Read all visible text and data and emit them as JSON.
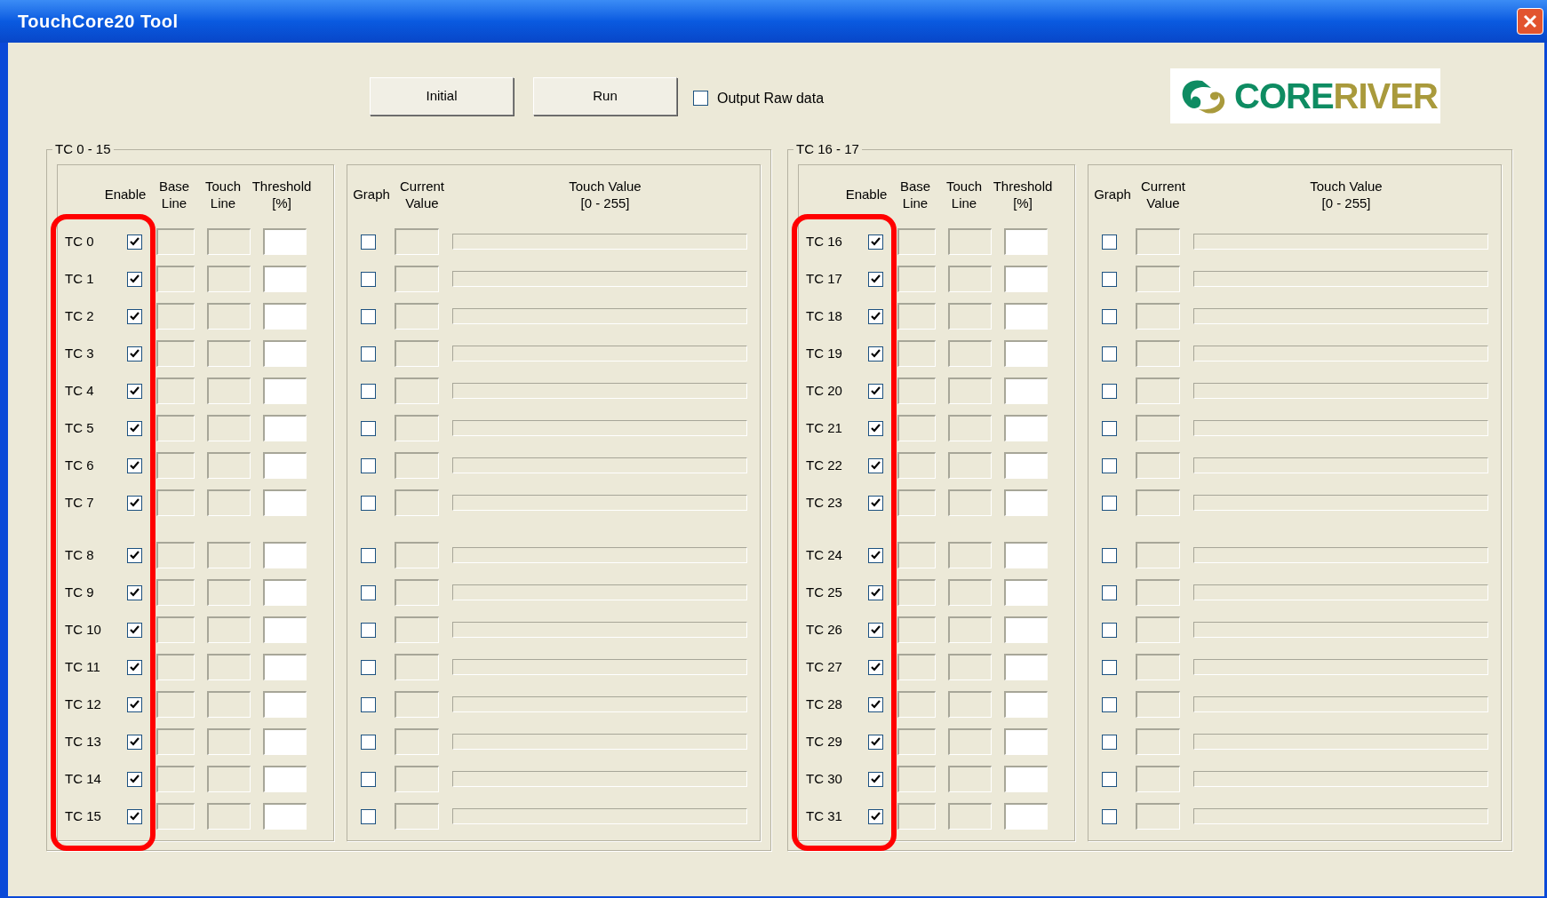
{
  "window": {
    "title": "TouchCore20 Tool"
  },
  "buttons": [
    "Initial",
    "Run"
  ],
  "raw_output": {
    "label": "Output Raw data",
    "checked": false
  },
  "logo": [
    {
      "text": "CORE",
      "color": "#0e8c62"
    },
    {
      "text": "RIVER",
      "color": "#a99a3c"
    }
  ],
  "groups": [
    {
      "title": "TC 0 - 15",
      "headers": {
        "enable": "Enable",
        "base_line": "Base\nLine",
        "touch_line": "Touch\nLine",
        "threshold": "Threshold\n[%]",
        "graph": "Graph",
        "current_value": "Current\nValue",
        "touch_value": "Touch Value\n[0 - 255]"
      },
      "channels": [
        {
          "label": "TC 0",
          "enabled": true,
          "graph": false,
          "level": 0
        },
        {
          "label": "TC 1",
          "enabled": true,
          "graph": false,
          "level": 0
        },
        {
          "label": "TC 2",
          "enabled": true,
          "graph": false,
          "level": 0
        },
        {
          "label": "TC 3",
          "enabled": true,
          "graph": false,
          "level": 0
        },
        {
          "label": "TC 4",
          "enabled": true,
          "graph": false,
          "level": 0
        },
        {
          "label": "TC 5",
          "enabled": true,
          "graph": false,
          "level": 0
        },
        {
          "label": "TC 6",
          "enabled": true,
          "graph": false,
          "level": 0
        },
        {
          "label": "TC 7",
          "enabled": true,
          "graph": false,
          "level": 0
        },
        {
          "label": "TC 8",
          "enabled": true,
          "graph": false,
          "level": 0
        },
        {
          "label": "TC 9",
          "enabled": true,
          "graph": false,
          "level": 0
        },
        {
          "label": "TC 10",
          "enabled": true,
          "graph": false,
          "level": 0
        },
        {
          "label": "TC 11",
          "enabled": true,
          "graph": false,
          "level": 0
        },
        {
          "label": "TC 12",
          "enabled": true,
          "graph": false,
          "level": 0
        },
        {
          "label": "TC 13",
          "enabled": true,
          "graph": false,
          "level": 0
        },
        {
          "label": "TC 14",
          "enabled": true,
          "graph": false,
          "level": 0
        },
        {
          "label": "TC 15",
          "enabled": true,
          "graph": false,
          "level": 0
        }
      ]
    },
    {
      "title": "TC 16 - 17",
      "headers": {
        "enable": "Enable",
        "base_line": "Base\nLine",
        "touch_line": "Touch\nLine",
        "threshold": "Threshold\n[%]",
        "graph": "Graph",
        "current_value": "Current\nValue",
        "touch_value": "Touch Value\n[0 - 255]"
      },
      "channels": [
        {
          "label": "TC 16",
          "enabled": true,
          "graph": false,
          "level": 0
        },
        {
          "label": "TC 17",
          "enabled": true,
          "graph": false,
          "level": 0
        },
        {
          "label": "TC 18",
          "enabled": true,
          "graph": false,
          "level": 0
        },
        {
          "label": "TC 19",
          "enabled": true,
          "graph": false,
          "level": 0
        },
        {
          "label": "TC 20",
          "enabled": true,
          "graph": false,
          "level": 0
        },
        {
          "label": "TC 21",
          "enabled": true,
          "graph": false,
          "level": 0
        },
        {
          "label": "TC 22",
          "enabled": true,
          "graph": false,
          "level": 0
        },
        {
          "label": "TC 23",
          "enabled": true,
          "graph": false,
          "level": 0
        },
        {
          "label": "TC 24",
          "enabled": true,
          "graph": false,
          "level": 0
        },
        {
          "label": "TC 25",
          "enabled": true,
          "graph": false,
          "level": 0
        },
        {
          "label": "TC 26",
          "enabled": true,
          "graph": false,
          "level": 0
        },
        {
          "label": "TC 27",
          "enabled": true,
          "graph": false,
          "level": 0
        },
        {
          "label": "TC 28",
          "enabled": true,
          "graph": false,
          "level": 0
        },
        {
          "label": "TC 29",
          "enabled": true,
          "graph": false,
          "level": 0
        },
        {
          "label": "TC 30",
          "enabled": true,
          "graph": false,
          "level": 0
        },
        {
          "label": "TC 31",
          "enabled": true,
          "graph": false,
          "level": 0
        }
      ]
    }
  ]
}
